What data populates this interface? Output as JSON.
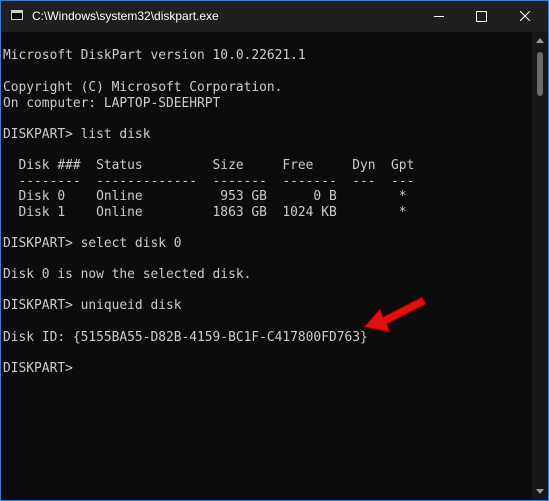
{
  "window": {
    "title": "C:\\Windows\\system32\\diskpart.exe"
  },
  "console": {
    "lines": [
      "Microsoft DiskPart version 10.0.22621.1",
      "",
      "Copyright (C) Microsoft Corporation.",
      "On computer: LAPTOP-SDEEHRPT",
      "",
      "DISKPART> list disk",
      "",
      "  Disk ###  Status         Size     Free     Dyn  Gpt",
      "  --------  -------------  -------  -------  ---  ---",
      "  Disk 0    Online          953 GB      0 B        *",
      "  Disk 1    Online         1863 GB  1024 KB        *",
      "",
      "DISKPART> select disk 0",
      "",
      "Disk 0 is now the selected disk.",
      "",
      "DISKPART> uniqueid disk",
      "",
      "Disk ID: {5155BA55-D82B-4159-BC1F-C417800FD763}",
      "",
      "DISKPART> "
    ]
  },
  "icons": {
    "app": "console-icon",
    "minimize": "minimize-icon",
    "maximize": "maximize-icon",
    "close": "close-icon",
    "annotation": "red-arrow-icon"
  },
  "colors": {
    "console_background": "#0c0c0c",
    "console_text": "#cccccc",
    "titlebar": "#1f1f1f",
    "window_border": "#3a7bd5",
    "annotation_arrow": "#e01010"
  }
}
